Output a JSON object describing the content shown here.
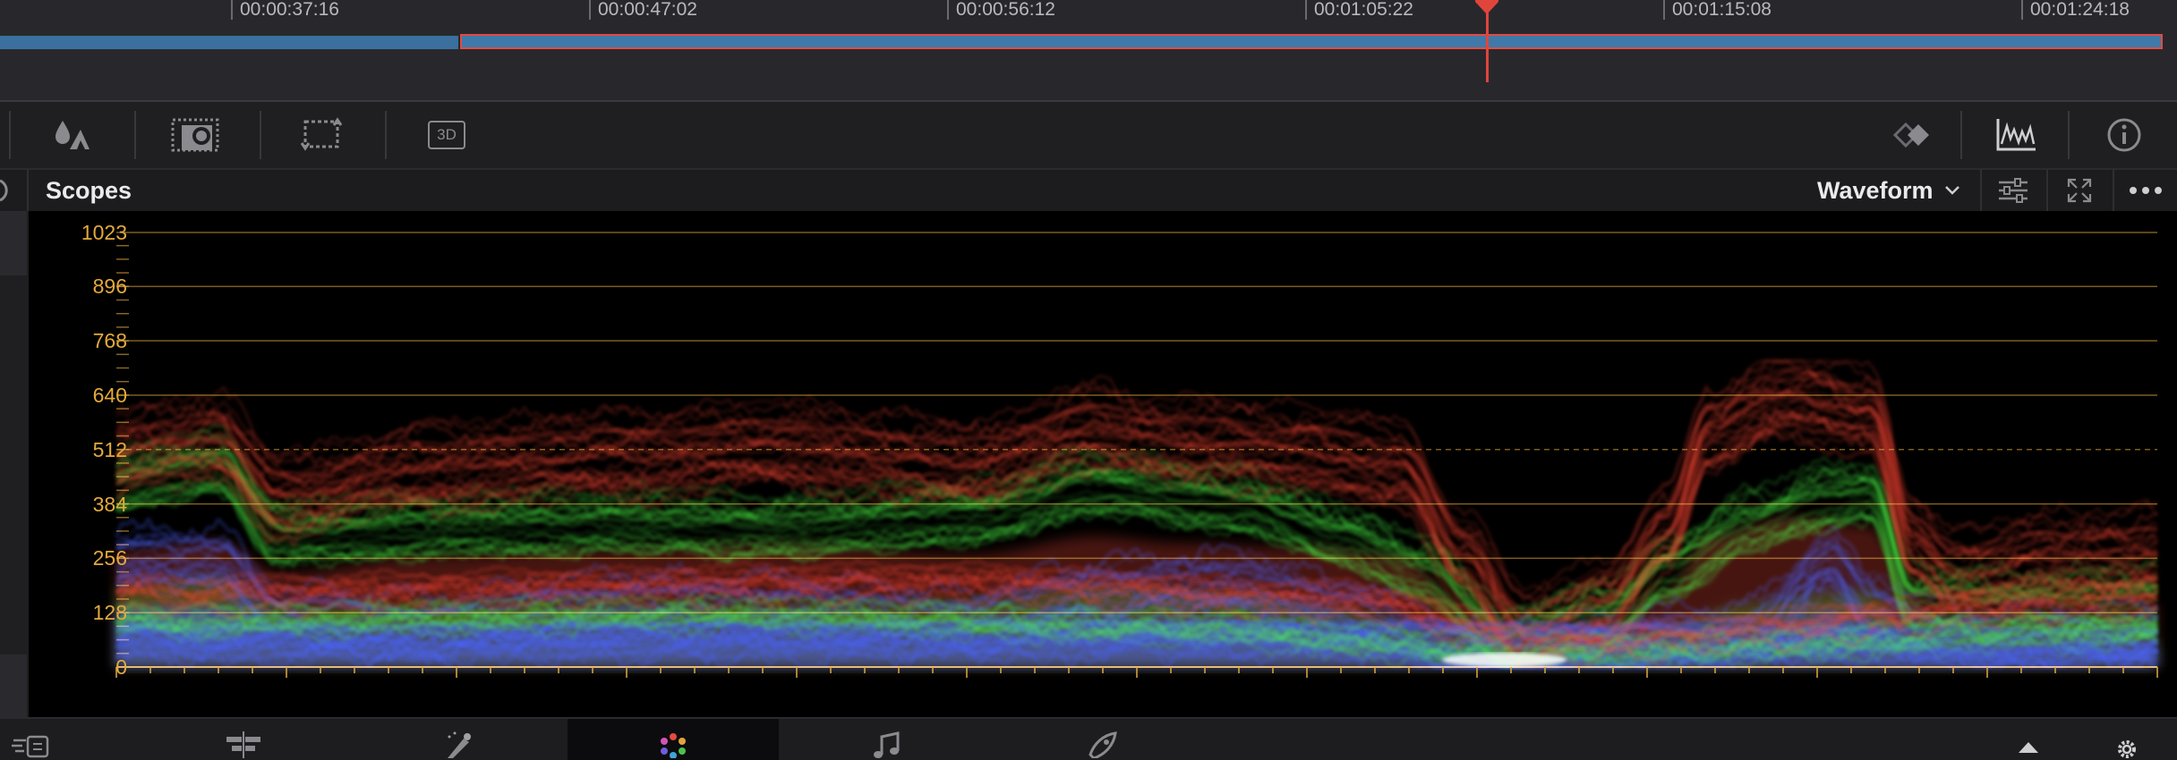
{
  "timeline": {
    "timecodes": [
      "00:00:37:16",
      "00:00:47:02",
      "00:00:56:12",
      "00:01:05:22",
      "00:01:15:08",
      "00:01:24:18"
    ]
  },
  "scopes": {
    "title": "Scopes",
    "mode": "Waveform",
    "y_ticks": [
      "1023",
      "896",
      "768",
      "640",
      "512",
      "384",
      "256",
      "128",
      "0"
    ]
  },
  "colors": {
    "playhead": "#e0453b",
    "clip": "#3f79aa",
    "graticule": "#e3a93d",
    "red_trace": "#ff4a3a",
    "green_trace": "#4cff4a",
    "blue_trace": "#4a62ff"
  },
  "toolbar": {
    "icons": [
      "color-warper-icon",
      "qualifier-icon",
      "window-icon",
      "tracker-icon",
      "3d-icon",
      "keyframes-icon",
      "scopes-icon",
      "info-icon"
    ],
    "badge_3d": "3D"
  },
  "page_bar": {
    "icons": [
      "cut-page-icon",
      "edit-page-icon",
      "fusion-page-icon",
      "color-page-icon",
      "fairlight-page-icon",
      "deliver-page-icon"
    ]
  }
}
